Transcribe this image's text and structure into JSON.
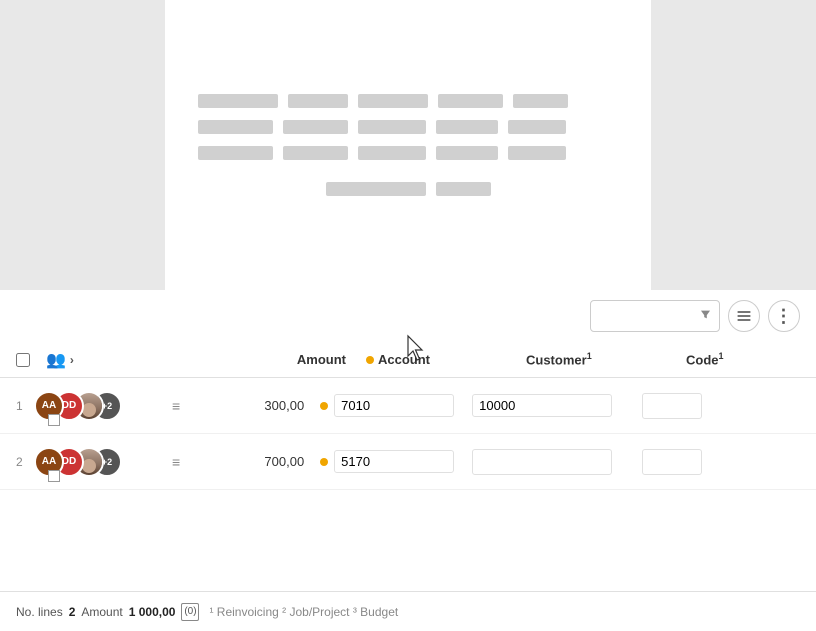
{
  "preview": {
    "skeleton_rows": [
      [
        80,
        60,
        70,
        65,
        55
      ],
      [
        75,
        65,
        68,
        62,
        58
      ],
      [
        100,
        55,
        null,
        null,
        null
      ]
    ]
  },
  "toolbar": {
    "search_placeholder": "",
    "filter_label": "filter",
    "list_view_label": "list-view",
    "more_label": "more"
  },
  "table": {
    "headers": {
      "amount": "Amount",
      "account": "Account",
      "customer": "Customer",
      "code": "Code"
    },
    "rows": [
      {
        "num": "1",
        "avatars": [
          "AA",
          "DD",
          "+2"
        ],
        "amount": "300,00",
        "account_dot": true,
        "account": "7010",
        "customer": "10000",
        "code": ""
      },
      {
        "num": "2",
        "avatars": [
          "AA",
          "DD",
          "+2"
        ],
        "amount": "700,00",
        "account_dot": true,
        "account": "5170",
        "customer": "",
        "code": ""
      }
    ]
  },
  "footer": {
    "no_lines_label": "No. lines",
    "no_lines_value": "2",
    "amount_label": "Amount",
    "amount_value": "1 000,00",
    "copy_label": "(0)",
    "footnote": "¹ Reinvoicing ² Job/Project ³ Budget"
  }
}
